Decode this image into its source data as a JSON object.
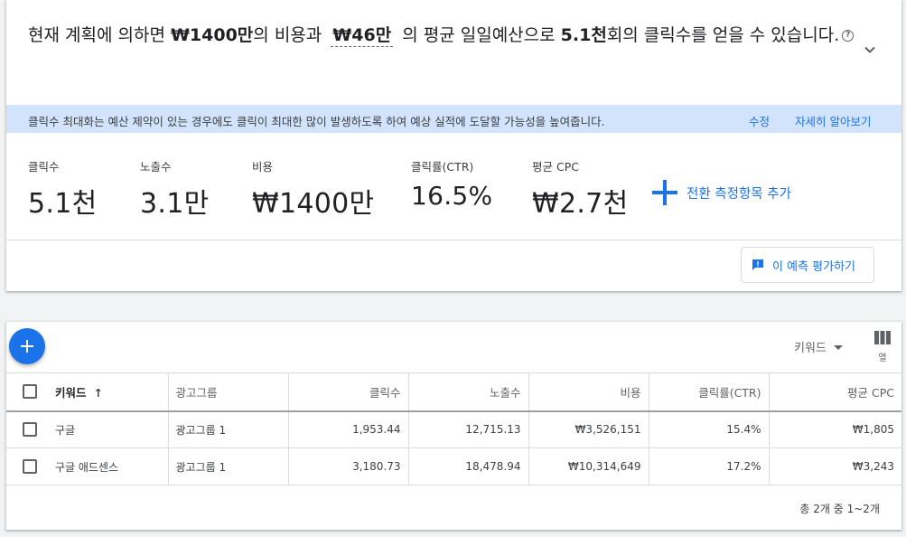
{
  "summary": {
    "prefix": "현재 계획에 의하면 ",
    "cost": "₩1400만",
    "middle1": "의 비용과 ",
    "daily_budget": "₩46만",
    "middle2": " 의 평균 일일예산으로 ",
    "clicks": "5.1천",
    "suffix": "회의 클릭수를 얻을 수 있습니다.",
    "help_glyph": "?"
  },
  "banner": {
    "message": "클릭수 최대화는 예산 제약이 있는 경우에도 클릭이 최대한 많이 발생하도록 하여 예상 실적에 도달할 가능성을 높여줍니다.",
    "edit_label": "수정",
    "learn_more_label": "자세히 알아보기"
  },
  "metrics": [
    {
      "label": "클릭수",
      "value": "5.1천"
    },
    {
      "label": "노출수",
      "value": "3.1만"
    },
    {
      "label": "비용",
      "value": "₩1400만"
    },
    {
      "label": "클릭률(CTR)",
      "value": "16.5%"
    },
    {
      "label": "평균 CPC",
      "value": "₩2.7천"
    }
  ],
  "add_conversion_label": "전환 측정항목 추가",
  "feedback_label": "이 예측 평가하기",
  "table_toolbar": {
    "level_label": "키워드",
    "columns_label": "열"
  },
  "table": {
    "headers": [
      "키워드",
      "광고그룹",
      "클릭수",
      "노출수",
      "비용",
      "클릭률(CTR)",
      "평균 CPC"
    ],
    "sort_glyph": "↑",
    "rows": [
      [
        "구글",
        "광고그룹 1",
        "1,953.44",
        "12,715.13",
        "₩3,526,151",
        "15.4%",
        "₩1,805"
      ],
      [
        "구글 애드센스",
        "광고그룹 1",
        "3,180.73",
        "18,478.94",
        "₩10,314,649",
        "17.2%",
        "₩3,243"
      ]
    ]
  },
  "pagination": "총 2개 중 1~2개",
  "colors": {
    "accent": "#1a73e8",
    "banner_bg": "#d2e3fc"
  }
}
